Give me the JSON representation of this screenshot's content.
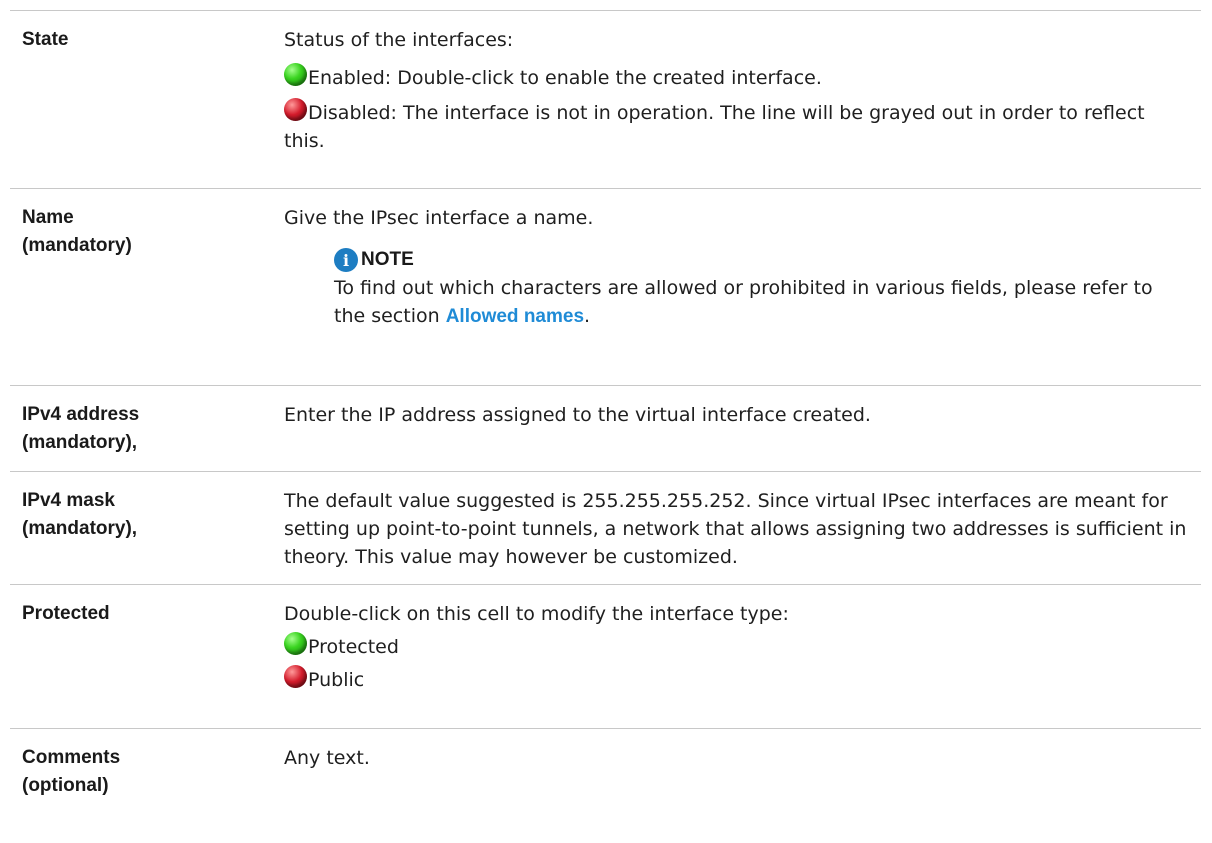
{
  "rows": {
    "state": {
      "label": "State",
      "intro": "Status of the interfaces:",
      "enabled": "Enabled: Double-click to enable the created interface.",
      "disabled": "Disabled: The interface is not in operation. The line will be grayed out in order to reflect this."
    },
    "name": {
      "label": "Name",
      "label_sub": "(mandatory)",
      "desc": "Give the IPsec interface a name.",
      "note_title": "NOTE",
      "note_text": "To find out which characters are allowed or prohibited in various fields, please refer to the section ",
      "note_link": "Allowed names",
      "note_end": "."
    },
    "ipv4_address": {
      "label": "IPv4 address",
      "label_sub": "(mandatory),",
      "desc": "Enter the IP address assigned to the virtual interface created."
    },
    "ipv4_mask": {
      "label": "IPv4 mask",
      "label_sub": "(mandatory),",
      "desc": "The default value suggested is 255.255.255.252. Since virtual IPsec interfaces are meant for setting up point-to-point tunnels, a network that allows assigning two addresses is sufficient in theory. This value may however be customized."
    },
    "protected": {
      "label": "Protected",
      "desc": "Double-click on this cell to modify the interface type:",
      "opt_protected": "Protected",
      "opt_public": "Public"
    },
    "comments": {
      "label": "Comments",
      "label_sub": "(optional)",
      "desc": "Any text."
    }
  },
  "icons": {
    "enabled": "green-dot-icon",
    "disabled": "red-dot-icon",
    "note": "info-icon"
  },
  "colors": {
    "link": "#1f8bd6",
    "note_icon": "#1d7dc2",
    "enabled": "#3ad420",
    "disabled": "#d41c2c"
  }
}
